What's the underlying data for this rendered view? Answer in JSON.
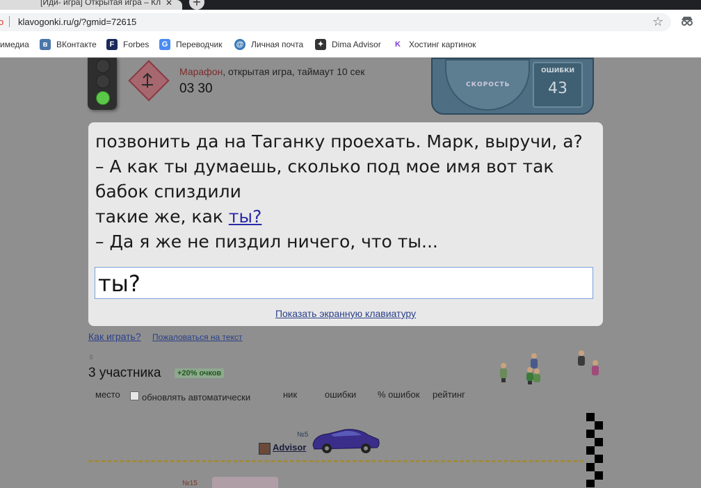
{
  "browser": {
    "tab_title": "[Иди- игра] Открытая игра – Кл",
    "new_tab_glyph": "+",
    "tab_close_glyph": "✕",
    "url_lead": "o",
    "url": "klavogonki.ru/g/?gmid=72615",
    "bookmarks": [
      {
        "label": "имедиа",
        "icon": "media-icon",
        "color": "#ffffff"
      },
      {
        "label": "ВКонтакте",
        "icon": "vk-icon",
        "color": "#4a76a8"
      },
      {
        "label": "Forbes",
        "icon": "forbes-icon",
        "color": "#1a2a5a"
      },
      {
        "label": "Переводчик",
        "icon": "translate-icon",
        "color": "#4a8af4"
      },
      {
        "label": "Личная почта",
        "icon": "mail-icon",
        "color": "#3a7ab8"
      },
      {
        "label": "Dima Advisor",
        "icon": "advisor-icon",
        "color": "#333333"
      },
      {
        "label": "Хостинг картинок",
        "icon": "image-hosting-icon",
        "color": "#7a3ad8"
      }
    ]
  },
  "game": {
    "mode_name": "Марафон",
    "mode_desc": ", открытая игра, таймаут 10 сек",
    "timer": "03 30",
    "speed_label": "СКОРОСТЬ",
    "errors_label": "ОШИБКИ",
    "errors_value": "43",
    "text_lines": [
      "позвонить да на Таганку проехать. Марк, выручи, а?",
      "– А как ты думаешь, сколько под мое имя вот так",
      "бабок спиздили",
      "такие же, как "
    ],
    "current_word": "ты?",
    "last_line": "– Да я же не пиздил ничего, что ты...",
    "input_value": "ты?",
    "keyboard_link": "Показать экранную клавиатуру",
    "how_to_play": "Как играть?",
    "complain": "Пожаловаться на текст",
    "participants": "3 участника",
    "bonus": "+20% очков",
    "columns": {
      "place": "место",
      "auto_update": "обновлять автоматически",
      "nick": "ник",
      "errors": "ошибки",
      "error_pct": "% ошибок",
      "rating": "рейтинг"
    },
    "player": {
      "num": "№5",
      "name": "Advisor"
    },
    "player2_num": "№15"
  }
}
